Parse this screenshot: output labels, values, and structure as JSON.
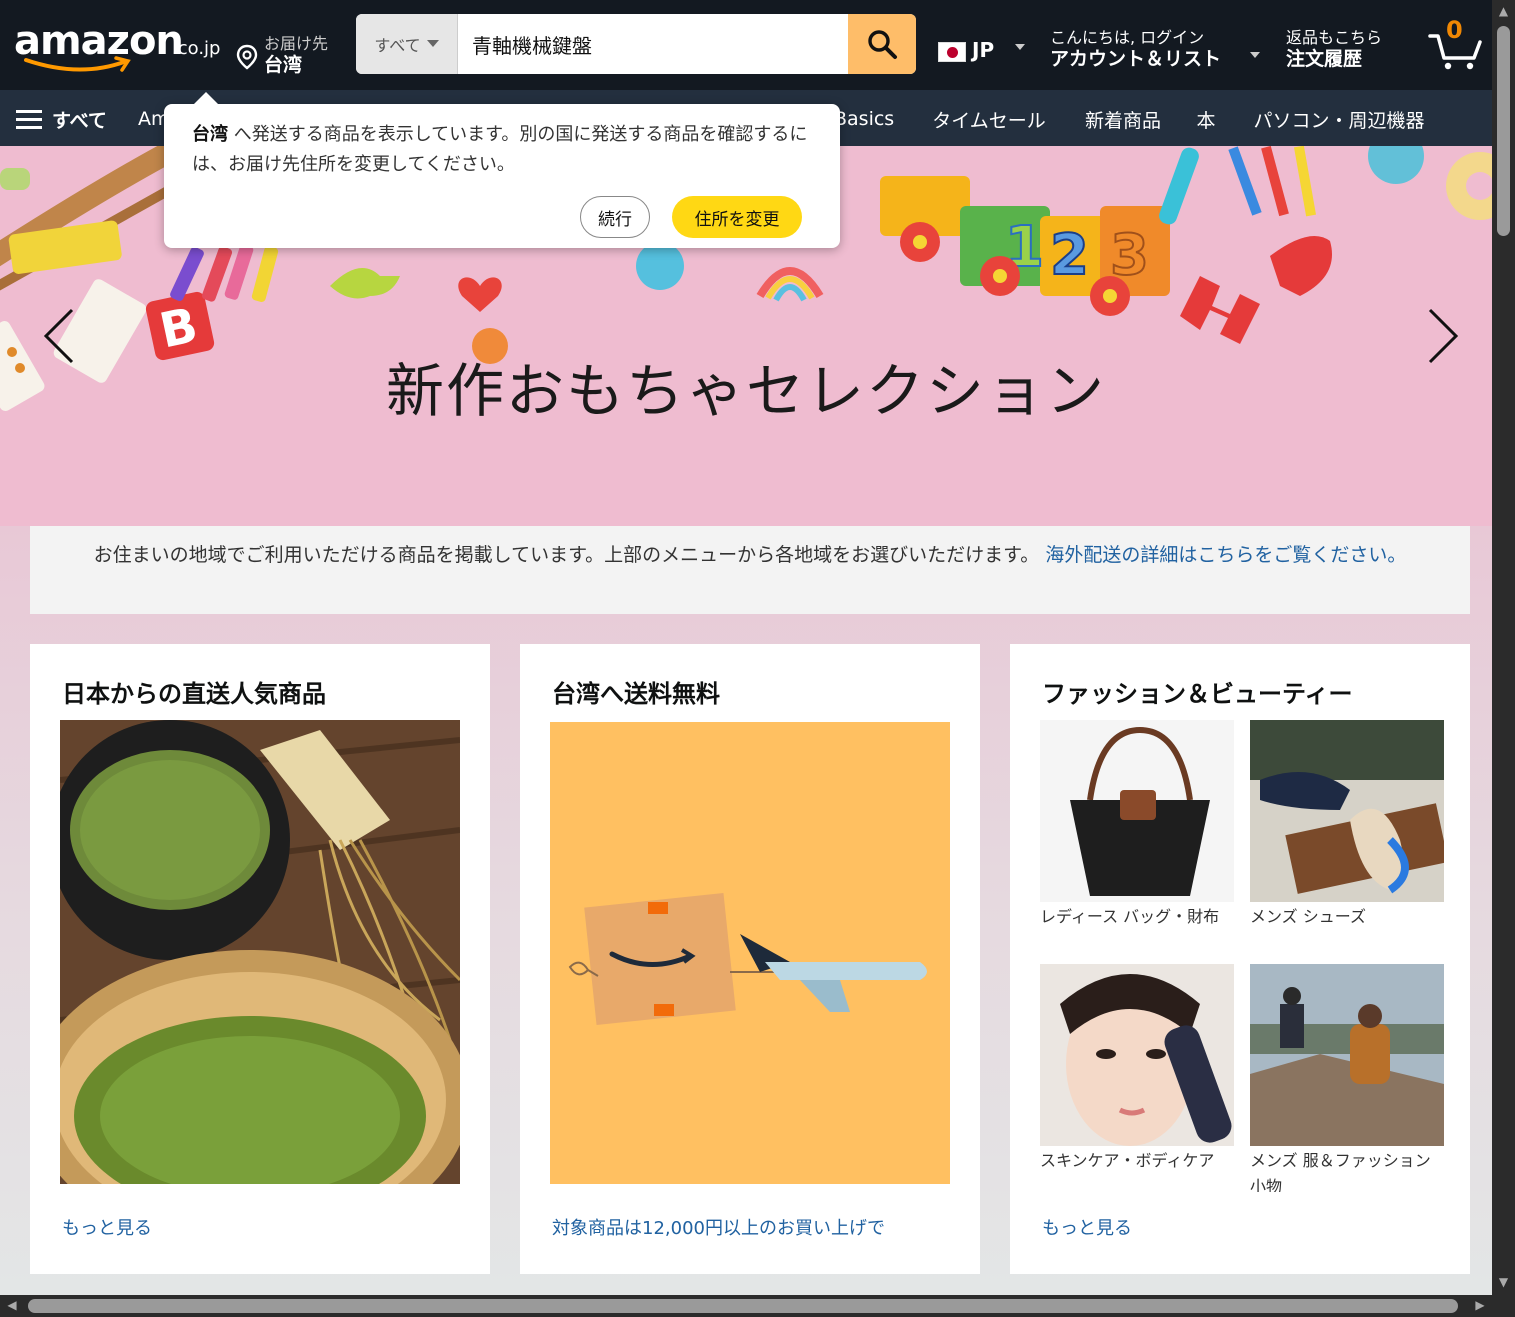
{
  "header": {
    "logo_text": "amazon",
    "logo_suffix": ".co.jp",
    "deliver_label": "お届け先",
    "deliver_country": "台湾",
    "search_category": "すべて",
    "search_value": "青軸機械鍵盤",
    "lang_code": "JP",
    "account_line1": "こんにちは, ログイン",
    "account_line2": "アカウント＆リスト",
    "orders_line1": "返品もこちら",
    "orders_line2": "注文履歴",
    "cart_count": "0"
  },
  "subnav": {
    "all": "すべて",
    "amazon_basics_partial": "Am",
    "basics": "Basics",
    "timesale": "タイムセール",
    "new_arrivals": "新着商品",
    "books": "本",
    "computers": "パソコン・周辺機器"
  },
  "popover": {
    "country": "台湾",
    "message": " へ発送する商品を表示しています。別の国に発送する商品を確認するには、お届け先住所を変更してください。",
    "continue_label": "続行",
    "change_label": "住所を変更"
  },
  "hero": {
    "title": "新作おもちゃセレクション"
  },
  "notice": {
    "text": "お住まいの地域でご利用いただける商品を掲載しています。上部のメニューから各地域をお選びいただけます。",
    "link": "海外配送の詳細はこちらをご覧ください。"
  },
  "cards": {
    "card1": {
      "title": "日本からの直送人気商品",
      "more": "もっと見る"
    },
    "card2": {
      "title": "台湾へ送料無料",
      "more": "対象商品は12,000円以上のお買い上げで"
    },
    "card3": {
      "title": "ファッション＆ビューティー",
      "items": [
        {
          "caption": "レディース バッグ・財布"
        },
        {
          "caption": "メンズ シューズ"
        },
        {
          "caption": "スキンケア・ボディケア"
        },
        {
          "caption": "メンズ 服＆ファッション小物"
        }
      ],
      "more": "もっと見る"
    }
  },
  "colors": {
    "navbar": "#131921",
    "subnav": "#232f3e",
    "search_button": "#febd69",
    "primary_button": "#ffd814",
    "link": "#2162a1",
    "cart_count": "#f08804"
  },
  "icons": [
    "location-pin-icon",
    "search-icon",
    "caret-down-icon",
    "cart-icon",
    "hamburger-icon",
    "chevron-left-icon",
    "chevron-right-icon"
  ]
}
